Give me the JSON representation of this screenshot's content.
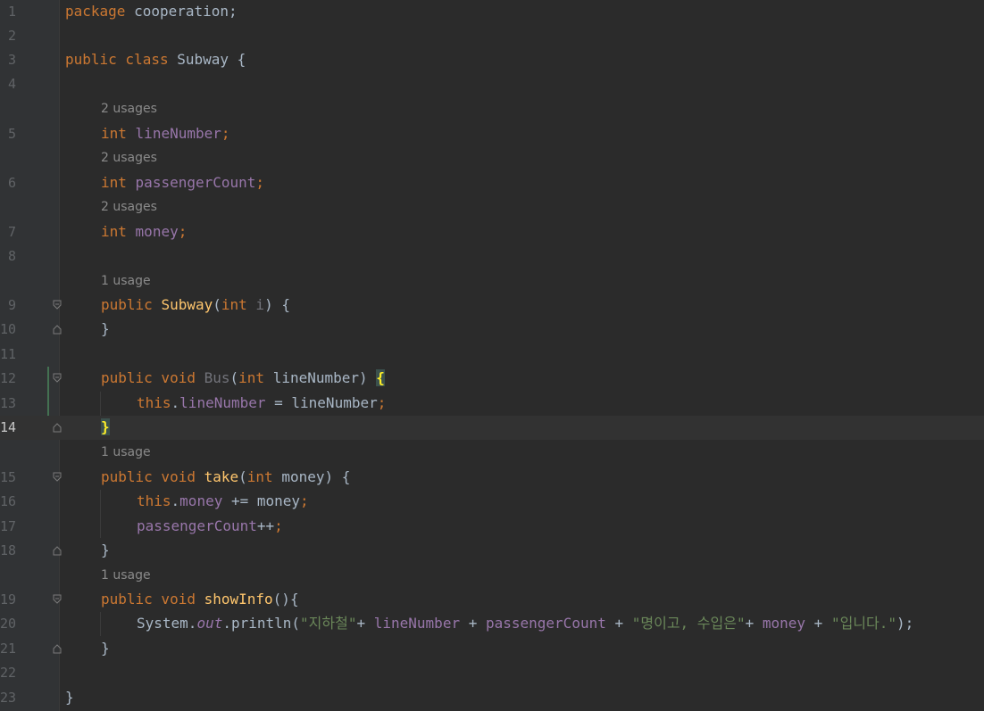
{
  "editor": {
    "language": "java",
    "current_line": 14,
    "colors": {
      "background": "#2b2b2b",
      "keyword": "#cc7832",
      "field": "#9876aa",
      "method": "#ffc66d",
      "string": "#6a8759",
      "plain": "#a9b7c6",
      "hint": "#8a8a8a",
      "line_number": "#606366",
      "brace_match": "#ffef28"
    },
    "line_numbers": [
      "1",
      "2",
      "3",
      "4",
      "5",
      "6",
      "7",
      "8",
      "9",
      "10",
      "11",
      "12",
      "13",
      "14",
      "15",
      "16",
      "17",
      "18",
      "19",
      "20",
      "21",
      "22",
      "23"
    ],
    "hints": {
      "h5": "2 usages",
      "h6": "2 usages",
      "h7": "2 usages",
      "h9": "1 usage",
      "h15": "1 usage",
      "h19": "1 usage"
    },
    "tokens": {
      "l1": [
        "package",
        " cooperation;"
      ],
      "l3": [
        "public class",
        " Subway {"
      ],
      "l5": [
        "int",
        " ",
        "lineNumber",
        ";"
      ],
      "l6": [
        "int",
        " ",
        "passengerCount",
        ";"
      ],
      "l7": [
        "int",
        " ",
        "money",
        ";"
      ],
      "l9": [
        "public",
        " ",
        "Subway",
        "(",
        "int",
        " ",
        "i",
        ") {"
      ],
      "l10": [
        "}"
      ],
      "l12": [
        "public void",
        " ",
        "Bus",
        "(",
        "int",
        " lineNumber) ",
        "{"
      ],
      "l13": [
        "this",
        ".",
        "lineNumber",
        " = lineNumber",
        ";"
      ],
      "l14": [
        "}"
      ],
      "l15": [
        "public void",
        " ",
        "take",
        "(",
        "int",
        " money) {"
      ],
      "l16": [
        "this",
        ".",
        "money",
        " += money",
        ";"
      ],
      "l17": [
        "passengerCount",
        "++",
        ";"
      ],
      "l18": [
        "}"
      ],
      "l19": [
        "public void",
        " ",
        "showInfo",
        "(){"
      ],
      "l20": [
        "System.",
        "out",
        ".println(",
        "\"지하철\"",
        "+ ",
        "lineNumber",
        " + ",
        "passengerCount",
        " + ",
        "\"명이고, 수입은\"",
        "+ ",
        "money",
        " + ",
        "\"입니다.\"",
        ");"
      ],
      "l21": [
        "}"
      ],
      "l23": [
        "}"
      ]
    }
  }
}
